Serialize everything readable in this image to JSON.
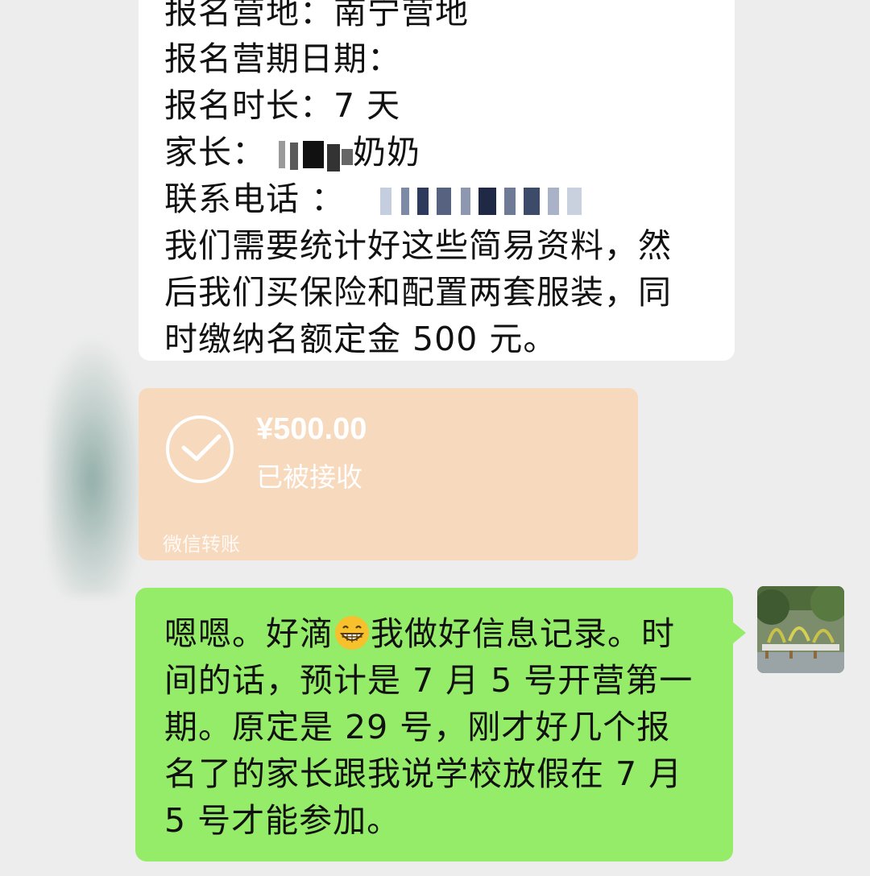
{
  "message_in": {
    "cut_top": "报名营地：南宁营地",
    "line1": "报名营期日期：",
    "line2": "报名时长：7 天",
    "parent_label": "家长：",
    "parent_suffix": "奶奶",
    "phone_label": "联系电话  ：",
    "line5": "我们需要统计好这些简易资料，然",
    "line6": "后我们买保险和配置两套服装，同",
    "line7": "时缴纳名额定金 500 元。"
  },
  "transfer": {
    "amount": "¥500.00",
    "status": "已被接收",
    "footer": "微信转账",
    "colors": {
      "card": "#f7d9bd",
      "text": "#ffffff"
    }
  },
  "message_out": {
    "l1a": "嗯嗯。好滴",
    "l1b": "我做好信息记录。时",
    "l2": "间的话，预计是 7 月 5 号开营第一",
    "l3": "期。原定是 29 号，刚才好几个报",
    "l4": "名了的家长跟我说学校放假在 7 月",
    "l5": "5 号才能参加。",
    "emoji": "grinning-face-icon",
    "colors": {
      "bubble": "#95ec69"
    }
  },
  "colors": {
    "background": "#ededed",
    "incoming": "#ffffff"
  }
}
